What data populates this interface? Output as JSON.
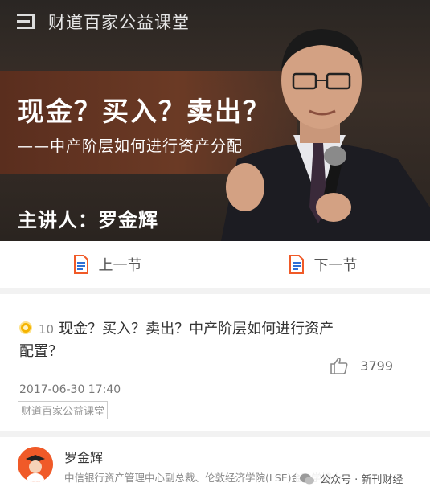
{
  "banner": {
    "brand_name": "财道百家公益课堂",
    "course_title": "现金？买入？卖出？",
    "course_subtitle": "——中产阶层如何进行资产分配",
    "lecturer_line": "主讲人：罗金辉"
  },
  "nav": {
    "prev_label": "上一节",
    "next_label": "下一节"
  },
  "article": {
    "count": "10",
    "title": "现金？买入？卖出？中产阶层如何进行资产配置？",
    "likes": "3799",
    "date": "2017-06-30 17:40",
    "source_tag": "财道百家公益课堂"
  },
  "author": {
    "name": "罗金辉",
    "bio": "中信银行资产管理中心副总裁、伦敦经济学院(LSE)金融学博士"
  },
  "watermark": {
    "text": "公众号 · 新刊财经"
  },
  "colors": {
    "accent_orange": "#f05a28",
    "coin_gold": "#f5b400",
    "banner_brown": "#6b3a25"
  }
}
